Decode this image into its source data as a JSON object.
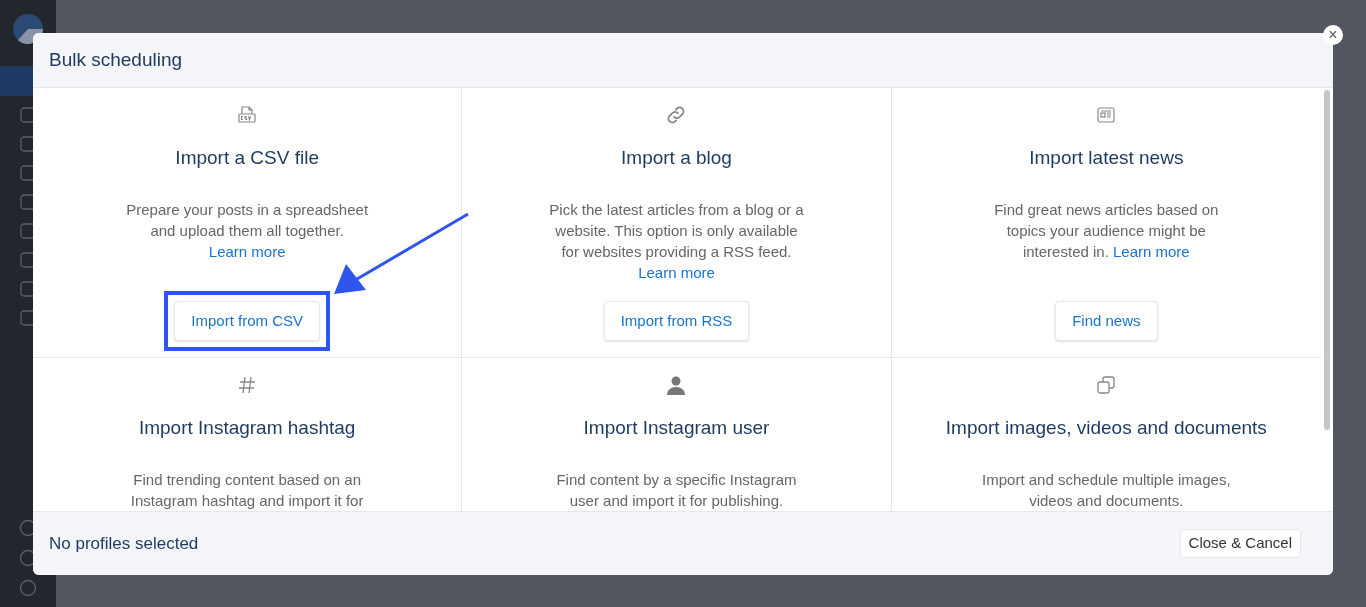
{
  "modal": {
    "title": "Bulk scheduling",
    "close": "×",
    "options": [
      {
        "title": "Import a CSV file",
        "description": "Prepare your posts in a spreadsheet and upload them all together.",
        "link": "Learn more",
        "button": "Import from CSV",
        "highlighted": true
      },
      {
        "title": "Import a blog",
        "description": "Pick the latest articles from a blog or a website. This option is only available for websites providing a RSS feed.",
        "link": "Learn more",
        "button": "Import from RSS",
        "highlighted": false
      },
      {
        "title": "Import latest news",
        "description": "Find great news articles based on topics your audience might be interested in.",
        "link": "Learn more",
        "button": "Find news",
        "highlighted": false
      },
      {
        "title": "Import Instagram hashtag",
        "description": "Find trending content based on an Instagram hashtag and import it for",
        "highlighted": false
      },
      {
        "title": "Import Instagram user",
        "description": "Find content by a specific Instagram user and import it for publishing.",
        "highlighted": false
      },
      {
        "title": "Import images, videos and documents",
        "description": "Import and schedule multiple images, videos and documents.",
        "highlighted": false
      }
    ],
    "footer": {
      "status": "No profiles selected",
      "button": "Close & Cancel"
    }
  }
}
